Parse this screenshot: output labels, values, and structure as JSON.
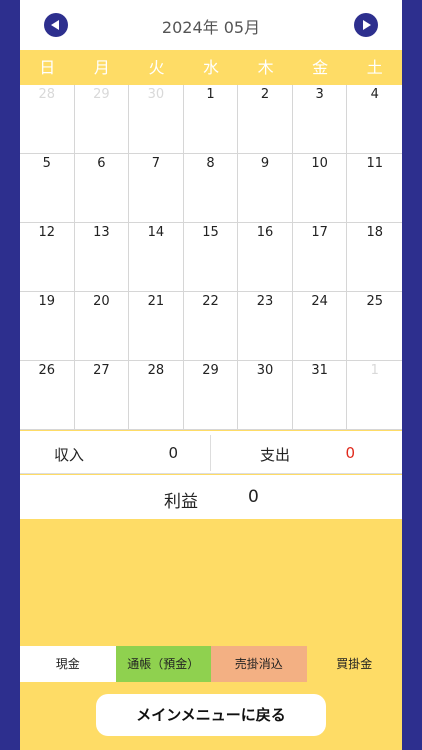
{
  "header": {
    "title": "2024年 05月",
    "prev_icon": "chevron-left-icon",
    "next_icon": "chevron-right-icon"
  },
  "weekdays": [
    "日",
    "月",
    "火",
    "水",
    "木",
    "金",
    "土"
  ],
  "calendar": {
    "days": [
      {
        "day": "28",
        "muted": true
      },
      {
        "day": "29",
        "muted": true
      },
      {
        "day": "30",
        "muted": true
      },
      {
        "day": "1"
      },
      {
        "day": "2"
      },
      {
        "day": "3"
      },
      {
        "day": "4"
      },
      {
        "day": "5"
      },
      {
        "day": "6"
      },
      {
        "day": "7"
      },
      {
        "day": "8"
      },
      {
        "day": "9"
      },
      {
        "day": "10"
      },
      {
        "day": "11"
      },
      {
        "day": "12"
      },
      {
        "day": "13"
      },
      {
        "day": "14"
      },
      {
        "day": "15"
      },
      {
        "day": "16"
      },
      {
        "day": "17"
      },
      {
        "day": "18"
      },
      {
        "day": "19"
      },
      {
        "day": "20"
      },
      {
        "day": "21"
      },
      {
        "day": "22"
      },
      {
        "day": "23"
      },
      {
        "day": "24"
      },
      {
        "day": "25"
      },
      {
        "day": "26"
      },
      {
        "day": "27"
      },
      {
        "day": "28"
      },
      {
        "day": "29"
      },
      {
        "day": "30"
      },
      {
        "day": "31"
      },
      {
        "day": "1",
        "muted": true
      }
    ]
  },
  "summary": {
    "income_label": "収入",
    "income_value": "0",
    "expense_label": "支出",
    "expense_value": "0",
    "profit_label": "利益",
    "profit_value": "0"
  },
  "tabs": [
    {
      "label": "現金"
    },
    {
      "label": "通帳（預金）"
    },
    {
      "label": "売掛消込"
    },
    {
      "label": "買掛金"
    }
  ],
  "footer": {
    "back_label": "メインメニューに戻る"
  },
  "colors": {
    "frame": "#2d2f8e",
    "accent_yellow": "#fedc66",
    "expense_red": "#e02a1d",
    "tab_bank": "#8fd14f",
    "tab_receivable": "#f3b083"
  }
}
